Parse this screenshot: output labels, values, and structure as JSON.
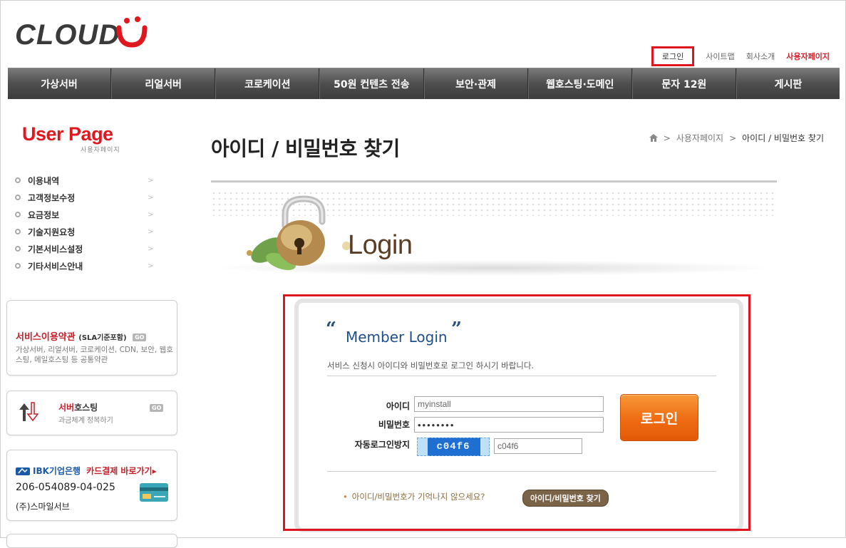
{
  "header": {
    "logo": "CLOUD",
    "top_links": {
      "login": "로그인",
      "sitemap": "사이트맵",
      "company": "회사소개",
      "user_page": "사용자페이지"
    }
  },
  "gnb": {
    "items": [
      "가상서버",
      "리얼서버",
      "코로케이션",
      "50원 컨텐츠 전송",
      "보안·관제",
      "웹호스팅·도메인",
      "문자 12원",
      "게시판"
    ]
  },
  "sidebar": {
    "title": "User Page",
    "subtitle": "사용자페이지",
    "menu": [
      "이용내역",
      "고객정보수정",
      "요금정보",
      "기술지원요청",
      "기본서비스설정",
      "기타서비스안내"
    ],
    "menu_arrow": ">",
    "terms": {
      "title": "서비스이용약관",
      "suffix": "(SLA기준포함)",
      "go": "GO",
      "desc": "가상서버, 리얼서버, 코로케이션, CDN, 보안, 웹호스팅, 메일호스팅 등 공통약관"
    },
    "hosting": {
      "title_prefix": "서버",
      "title_rest": "호스팅",
      "desc": "과금체계 정복하기",
      "go": "GO"
    },
    "bank": {
      "name": "IBK기업은행",
      "card_pay": "카드결제 바로가기▸",
      "account": "206-054089-04-025",
      "owner": "(주)스마일서브"
    }
  },
  "main": {
    "page_title": "아이디 / 비밀번호 찾기",
    "breadcrumb": {
      "sep": ">",
      "parent": "사용자페이지",
      "current": "아이디 / 비밀번호 찾기"
    },
    "banner_word": "Login",
    "login": {
      "title": "Member Login",
      "open_quote": "“",
      "close_quote": "”",
      "instruction": "서비스 신청시 아이디와 비밀번호로 로그인 하시기 바랍니다.",
      "id_label": "아이디",
      "id_value": "myinstall",
      "pw_label": "비밀번호",
      "pw_value": "••••••••",
      "captcha_label": "자동로그인방지",
      "captcha_image_text": "c04f6",
      "captcha_value": "c04f6",
      "button": "로그인",
      "forgot_text": "아이디/비밀번호가 기억나지 않으세요?",
      "forgot_bullet": "•",
      "find_button": "아이디/비밀번호 찾기"
    }
  },
  "colors": {
    "brand_red": "#e0171e",
    "nav_dark": "#4e4e4e",
    "login_orange": "#ee6b12",
    "title_blue": "#1f4f8a",
    "highlight_red": "#e0141e"
  }
}
